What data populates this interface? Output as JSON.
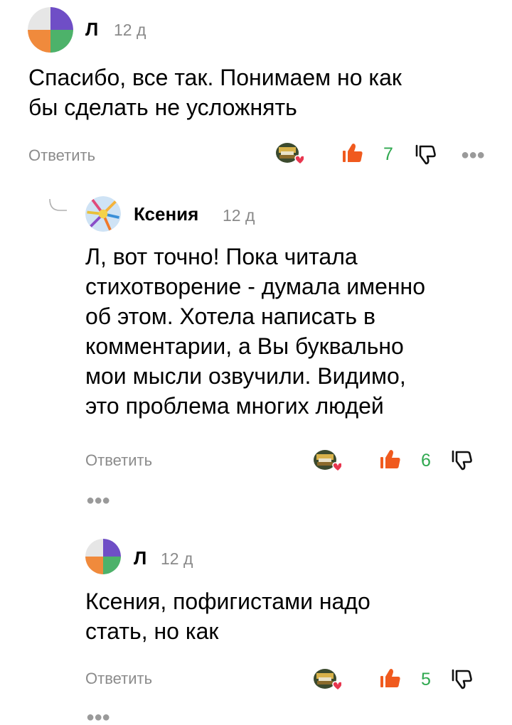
{
  "comments": [
    {
      "author": "Л",
      "time": "12 д",
      "text_lines": [
        "Спасибо, все так. Понимаем но как",
        "бы сделать не усложнять"
      ],
      "reply_label": "Ответить",
      "likes": "7"
    },
    {
      "author": "Ксения",
      "time": "12 д",
      "text_lines": [
        "Л, вот точно! Пока читала",
        "стихотворение - думала именно",
        "об этом. Хотела написать в",
        "комментарии, а Вы буквально",
        "мои мысли озвучили. Видимо,",
        "это проблема многих людей"
      ],
      "reply_label": "Ответить",
      "likes": "6"
    },
    {
      "author": "Л",
      "time": "12 д",
      "text_lines": [
        "Ксения, пофигистами надо",
        "стать, но как"
      ],
      "reply_label": "Ответить",
      "likes": "5"
    }
  ],
  "colors": {
    "like": "#f05a1e",
    "count": "#2fa84f",
    "avatar_purple": "#6f4ec6",
    "avatar_green": "#4db26a",
    "avatar_orange": "#f08a3c",
    "avatar_grey": "#e6e6e6",
    "heart": "#e8364f"
  },
  "icons": [
    "more-dots-icon",
    "author-heart-icon",
    "like-icon",
    "dislike-icon",
    "reply-thread-icon"
  ]
}
